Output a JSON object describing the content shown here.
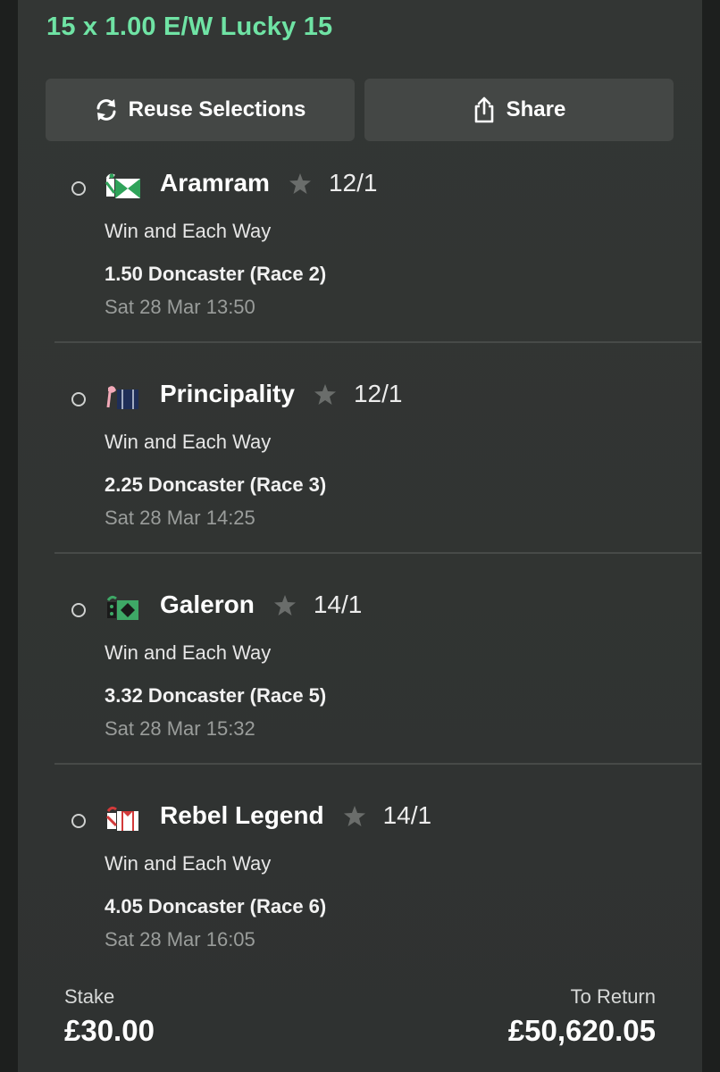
{
  "bet": {
    "title": "15 x 1.00 E/W Lucky 15",
    "reuse_label": "Reuse Selections",
    "share_label": "Share"
  },
  "selections": [
    {
      "name": "Aramram",
      "odds": "12/1",
      "market": "Win and Each Way",
      "race": "1.50 Doncaster (Race 2)",
      "date": "Sat 28 Mar 13:50"
    },
    {
      "name": "Principality",
      "odds": "12/1",
      "market": "Win and Each Way",
      "race": "2.25 Doncaster (Race 3)",
      "date": "Sat 28 Mar 14:25"
    },
    {
      "name": "Galeron",
      "odds": "14/1",
      "market": "Win and Each Way",
      "race": "3.32 Doncaster (Race 5)",
      "date": "Sat 28 Mar 15:32"
    },
    {
      "name": "Rebel Legend",
      "odds": "14/1",
      "market": "Win and Each Way",
      "race": "4.05 Doncaster (Race 6)",
      "date": "Sat 28 Mar 16:05"
    }
  ],
  "footer": {
    "stake_label": "Stake",
    "stake_value": "£30.00",
    "return_label": "To Return",
    "return_value": "£50,620.05"
  },
  "colors": {
    "accent": "#6fe3a4",
    "background": "#333634",
    "button": "#444745"
  },
  "icons": {
    "reuse": "refresh-icon",
    "share": "share-icon",
    "favourite": "star-icon",
    "silks": [
      "silk-aramram-icon",
      "silk-principality-icon",
      "silk-galeron-icon",
      "silk-rebel-legend-icon"
    ]
  }
}
